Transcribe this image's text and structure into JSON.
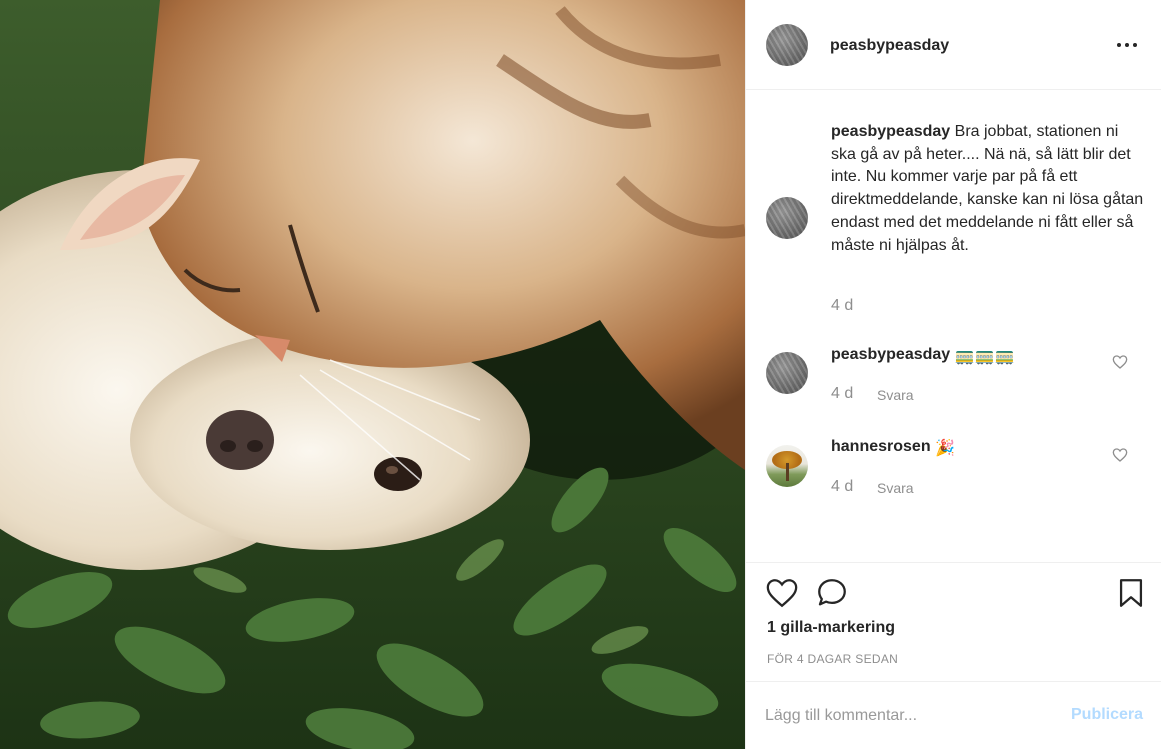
{
  "post": {
    "author": "peasbypeasday",
    "image_alt": "cat and dog lying together on grass"
  },
  "caption": {
    "username": "peasbypeasday",
    "text": "Bra jobbat, stationen ni ska gå av på heter.... Nä nä, så lätt blir det inte. Nu kommer varje par på få ett direktmeddelande, kanske kan ni lösa gåtan endast med det meddelande ni fått eller så måste ni hjälpas åt.",
    "time": "4 d"
  },
  "comments": [
    {
      "username": "peasbypeasday",
      "emoji": "🚃🚃🚃",
      "time": "4 d",
      "reply_label": "Svara"
    },
    {
      "username": "hannesrosen",
      "emoji": "🎉",
      "time": "4 d",
      "reply_label": "Svara"
    }
  ],
  "likes": "1 gilla-markering",
  "posted_ago": "FÖR 4 DAGAR SEDAN",
  "comment_box": {
    "placeholder": "Lägg till kommentar...",
    "publish_label": "Publicera"
  },
  "colors": {
    "text": "#262626",
    "muted": "#8e8e8e",
    "publish_disabled": "#b3dbff",
    "border": "#efefef"
  }
}
